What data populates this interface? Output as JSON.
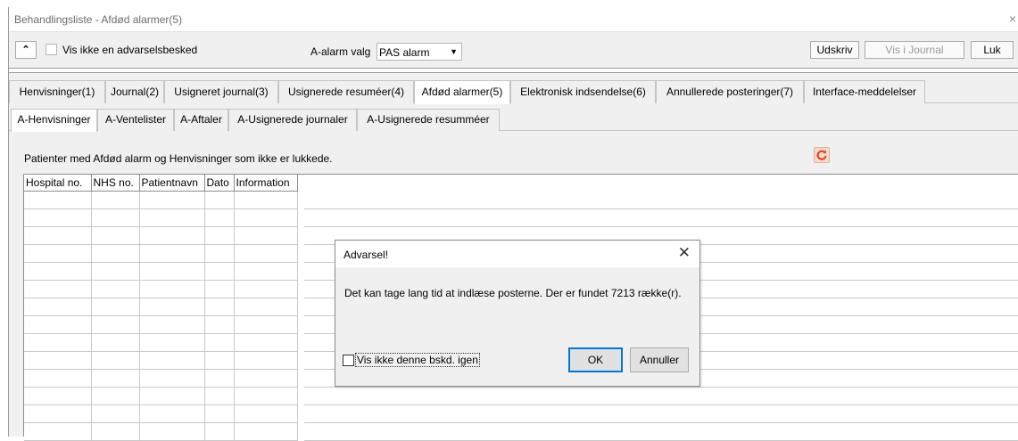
{
  "window": {
    "title": "Behandlingsliste - Afdød alarmer(5)",
    "close_glyph": "×"
  },
  "toolbar": {
    "collapse_glyph": "⌃",
    "hide_warning_label": "Vis ikke en advarselsbesked",
    "alarm_label": "A-alarm valg",
    "alarm_value": "PAS alarm",
    "print_label": "Udskriv",
    "show_journal_label": "Vis i Journal",
    "close_label": "Luk"
  },
  "main_tabs": [
    {
      "label": "Henvisninger(1)"
    },
    {
      "label": "Journal(2)"
    },
    {
      "label": "Usigneret journal(3)"
    },
    {
      "label": "Usignerede resuméer(4)"
    },
    {
      "label": "Afdød alarmer(5)"
    },
    {
      "label": "Elektronisk indsendelse(6)"
    },
    {
      "label": "Annullerede posteringer(7)"
    },
    {
      "label": "Interface-meddelelser"
    }
  ],
  "sub_tabs": [
    {
      "label": "A-Henvisninger"
    },
    {
      "label": "A-Ventelister"
    },
    {
      "label": "A-Aftaler"
    },
    {
      "label": "A-Usignerede journaler"
    },
    {
      "label": "A-Usignerede resumméer"
    }
  ],
  "panel": {
    "description": "Patienter med Afdød alarm og Henvisninger som ikke er lukkede."
  },
  "grid": {
    "columns": [
      "Hospital no.",
      "NHS no.",
      "Patientnavn",
      "Dato",
      "Information"
    ],
    "rows": []
  },
  "dialog": {
    "title": "Advarsel!",
    "close_glyph": "✕",
    "message": "Det kan tage lang tid at indlæse posterne. Der er fundet 7213 række(r).",
    "dont_show_label": "Vis ikke denne bskd. igen",
    "ok_label": "OK",
    "cancel_label": "Annuller"
  },
  "colors": {
    "window_bg": "#f0f0f0",
    "refresh_icon_bg": "#f9d9cc",
    "ok_focus": "#0078d7"
  },
  "icons": {
    "refresh": "refresh-icon"
  }
}
